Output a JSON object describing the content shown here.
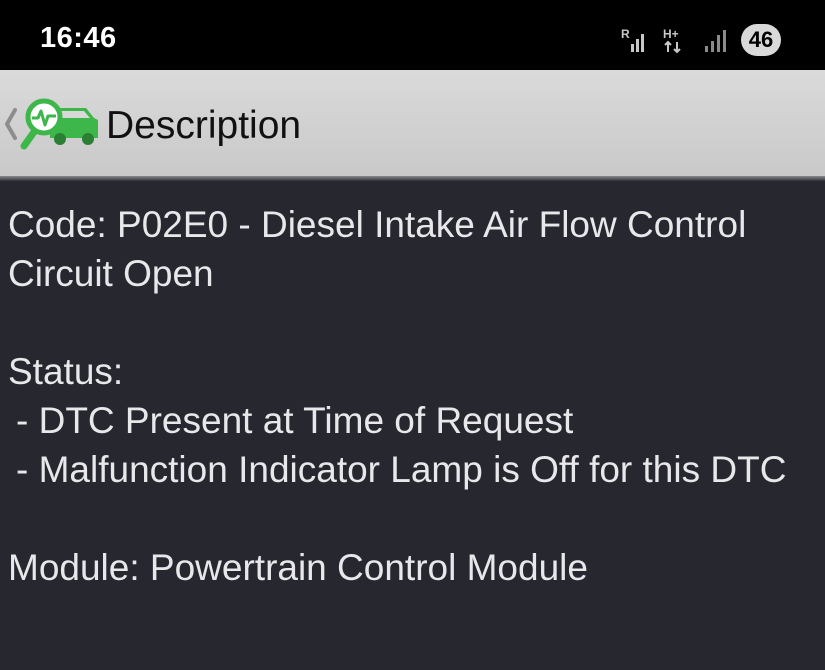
{
  "status_bar": {
    "time": "16:46",
    "battery": "46",
    "icons": [
      "signal-r-icon",
      "hplus-data-icon",
      "signal-icon",
      "battery-icon"
    ]
  },
  "action_bar": {
    "title": "Description",
    "back_icon": "chevron-left-icon",
    "app_icon": "car-diagnostic-icon"
  },
  "description": {
    "code_line": "Code: P02E0 - Diesel Intake Air Flow Control Circuit Open",
    "status_label": "Status:",
    "status_items": [
      " - DTC Present at Time of Request",
      " - Malfunction Indicator Lamp is Off for this DTC"
    ],
    "module_line": "Module: Powertrain Control Module"
  },
  "colors": {
    "background": "#272730",
    "action_bar": "#d3d3d3",
    "icon_green": "#3db64a"
  }
}
